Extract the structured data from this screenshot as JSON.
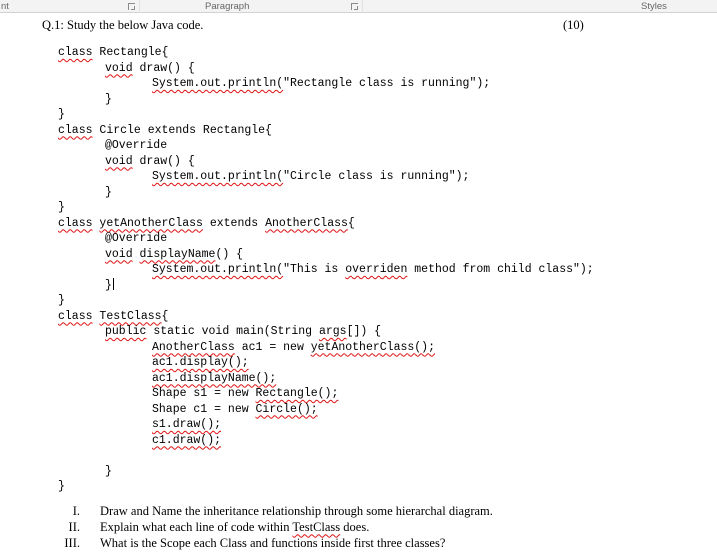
{
  "ribbon": {
    "font_group_label": "nt",
    "paragraph_label": "Paragraph",
    "styles_label": "Styles"
  },
  "header": {
    "question": "Q.1: Study the below Java code.",
    "marks": "(10)"
  },
  "colors": {
    "spell_error": "#e01010"
  },
  "code": {
    "lines": [
      {
        "ind": 0,
        "seg": [
          [
            "class",
            1
          ],
          [
            " Rectangle{",
            0
          ]
        ]
      },
      {
        "ind": 1,
        "seg": [
          [
            "void",
            1
          ],
          [
            " draw() {",
            0
          ]
        ]
      },
      {
        "ind": 2,
        "seg": [
          [
            "System.out.println(",
            1
          ],
          [
            "\"Rectangle class is running\");",
            0
          ]
        ]
      },
      {
        "ind": 1,
        "seg": [
          [
            "}",
            0
          ]
        ]
      },
      {
        "ind": 0,
        "seg": [
          [
            "}",
            0
          ]
        ]
      },
      {
        "ind": 0,
        "seg": [
          [
            "class",
            1
          ],
          [
            " Circle extends Rectangle{",
            0
          ]
        ]
      },
      {
        "ind": 1,
        "seg": [
          [
            "@Override",
            0
          ]
        ]
      },
      {
        "ind": 1,
        "seg": [
          [
            "void",
            1
          ],
          [
            " draw() {",
            0
          ]
        ]
      },
      {
        "ind": 2,
        "seg": [
          [
            "System.out.println(",
            1
          ],
          [
            "\"Circle class is running\");",
            0
          ]
        ]
      },
      {
        "ind": 1,
        "seg": [
          [
            "}",
            0
          ]
        ]
      },
      {
        "ind": 0,
        "seg": [
          [
            "}",
            0
          ]
        ]
      },
      {
        "ind": 0,
        "seg": [
          [
            "class",
            1
          ],
          [
            " ",
            0
          ],
          [
            "yetAnotherClass",
            1
          ],
          [
            " extends ",
            0
          ],
          [
            "AnotherClass",
            1
          ],
          [
            "{",
            0
          ]
        ]
      },
      {
        "ind": 1,
        "seg": [
          [
            "@Override",
            0
          ]
        ]
      },
      {
        "ind": 1,
        "seg": [
          [
            "void",
            1
          ],
          [
            " ",
            0
          ],
          [
            "displayName",
            1
          ],
          [
            "() {",
            0
          ]
        ]
      },
      {
        "ind": 2,
        "seg": [
          [
            "System.out.println(",
            1
          ],
          [
            "\"This is ",
            0
          ],
          [
            "overriden",
            1
          ],
          [
            " method from child class\");",
            0
          ]
        ]
      },
      {
        "ind": 1,
        "seg": [
          [
            "}",
            0
          ]
        ],
        "caret": true
      },
      {
        "ind": 0,
        "seg": [
          [
            "}",
            0
          ]
        ]
      },
      {
        "ind": 0,
        "seg": [
          [
            "class",
            1
          ],
          [
            " ",
            0
          ],
          [
            "TestClass",
            1
          ],
          [
            "{",
            0
          ]
        ]
      },
      {
        "ind": 1,
        "seg": [
          [
            "public",
            1
          ],
          [
            " static void main(String ",
            0
          ],
          [
            "args",
            1
          ],
          [
            "[]) {",
            0
          ]
        ]
      },
      {
        "ind": 2,
        "seg": [
          [
            "AnotherClass",
            1
          ],
          [
            " ac1 = new ",
            0
          ],
          [
            "yetAnotherClass();",
            1
          ]
        ]
      },
      {
        "ind": 2,
        "seg": [
          [
            "ac1.display();",
            1
          ]
        ]
      },
      {
        "ind": 2,
        "seg": [
          [
            "ac1.displayName();",
            1
          ]
        ]
      },
      {
        "ind": 2,
        "seg": [
          [
            "Shape s1 = new ",
            0
          ],
          [
            "Rectangle();",
            1
          ]
        ]
      },
      {
        "ind": 2,
        "seg": [
          [
            "Shape c1 = new ",
            0
          ],
          [
            "Circle();",
            1
          ]
        ]
      },
      {
        "ind": 2,
        "seg": [
          [
            "s1.draw();",
            1
          ]
        ]
      },
      {
        "ind": 2,
        "seg": [
          [
            "c1.draw();",
            1
          ]
        ]
      },
      {
        "ind": 0,
        "seg": []
      },
      {
        "ind": 1,
        "seg": [
          [
            "}",
            0
          ]
        ]
      },
      {
        "ind": 0,
        "seg": [
          [
            "}",
            0
          ]
        ]
      }
    ]
  },
  "questions": [
    {
      "num": "I.",
      "seg": [
        [
          "Draw and Name the inheritance relationship through some hierarchal diagram.",
          0
        ]
      ]
    },
    {
      "num": "II.",
      "seg": [
        [
          "Explain what each line of code within ",
          0
        ],
        [
          "TestClass",
          1
        ],
        [
          " does.",
          0
        ]
      ]
    },
    {
      "num": "III.",
      "seg": [
        [
          "What is the Scope each Class and functions inside first three classes?",
          0
        ]
      ]
    }
  ]
}
